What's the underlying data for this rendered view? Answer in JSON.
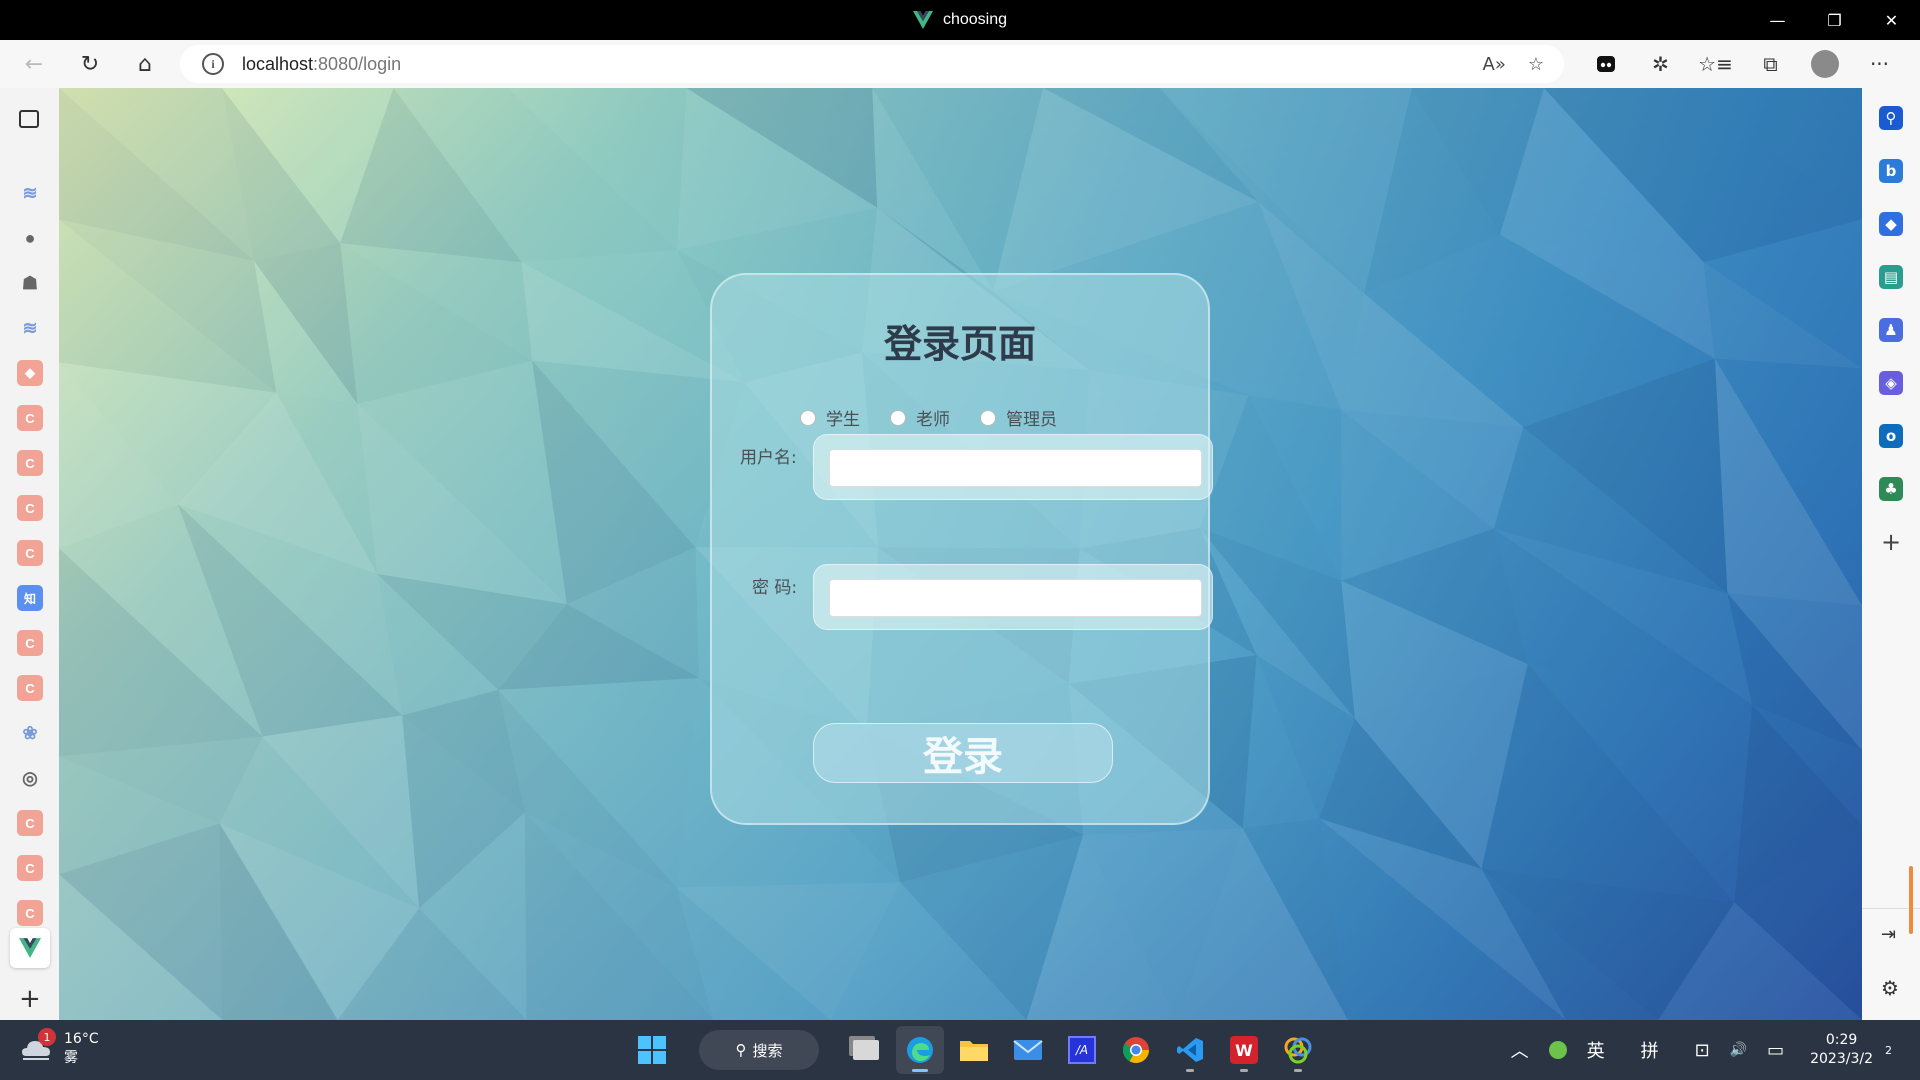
{
  "window": {
    "title": "choosing",
    "minimize_glyph": "—",
    "restore_glyph": "❐",
    "close_glyph": "✕"
  },
  "browser": {
    "url_host": "localhost",
    "url_path": ":8080/login",
    "info_glyph": "i",
    "back_glyph": "←",
    "refresh_glyph": "↻",
    "home_glyph": "⌂",
    "read_aloud_glyph": "A»",
    "favorite_add_glyph": "☆",
    "favorites_glyph": "☆≡",
    "collections_glyph": "⧉",
    "extensions_glyph": "✲",
    "more_glyph": "···"
  },
  "left_tabs": [
    {
      "icon": "layers-icon",
      "glyph": "≋",
      "kind": "soft"
    },
    {
      "icon": "github-icon",
      "glyph": "●",
      "kind": "grey"
    },
    {
      "icon": "robot-icon",
      "glyph": "☗",
      "kind": "grey"
    },
    {
      "icon": "layers-icon",
      "glyph": "≋",
      "kind": "soft"
    },
    {
      "icon": "git-icon",
      "glyph": "◆",
      "kind": "c"
    },
    {
      "icon": "csdn-icon",
      "glyph": "C",
      "kind": "c"
    },
    {
      "icon": "csdn-icon",
      "glyph": "C",
      "kind": "c"
    },
    {
      "icon": "csdn-icon",
      "glyph": "C",
      "kind": "c"
    },
    {
      "icon": "csdn-icon",
      "glyph": "C",
      "kind": "c"
    },
    {
      "icon": "zhihu-icon",
      "glyph": "知",
      "kind": "zh"
    },
    {
      "icon": "csdn-icon",
      "glyph": "C",
      "kind": "c"
    },
    {
      "icon": "csdn-icon",
      "glyph": "C",
      "kind": "c"
    },
    {
      "icon": "baidu-paw-icon",
      "glyph": "❀",
      "kind": "soft"
    },
    {
      "icon": "chrome-like-icon",
      "glyph": "◎",
      "kind": "grey"
    },
    {
      "icon": "csdn-icon",
      "glyph": "C",
      "kind": "c"
    },
    {
      "icon": "csdn-icon",
      "glyph": "C",
      "kind": "c"
    },
    {
      "icon": "csdn-icon",
      "glyph": "C",
      "kind": "c"
    }
  ],
  "left_new_tab_glyph": "+",
  "right_sidebar": [
    {
      "icon": "search-icon",
      "glyph": "⚲",
      "color": "#1a5bd1"
    },
    {
      "icon": "bing-icon",
      "glyph": "b",
      "color": "#2b7bd8"
    },
    {
      "icon": "tag-icon",
      "glyph": "◆",
      "color": "#2f6fe0"
    },
    {
      "icon": "toolbox-icon",
      "glyph": "▤",
      "color": "#2a9d8f"
    },
    {
      "icon": "games-icon",
      "glyph": "♟",
      "color": "#4a6ee0"
    },
    {
      "icon": "office-icon",
      "glyph": "◈",
      "color": "#6a5ee0"
    },
    {
      "icon": "outlook-icon",
      "glyph": "o",
      "color": "#0f6cbd"
    },
    {
      "icon": "tree-icon",
      "glyph": "♣",
      "color": "#2e8b57"
    }
  ],
  "right_add_glyph": "+",
  "right_bottom": {
    "split_glyph": "⇥",
    "settings_glyph": "⚙"
  },
  "login": {
    "title": "登录页面",
    "roles": [
      "学生",
      "老师",
      "管理员"
    ],
    "username_label": "用户名:",
    "password_label": "密 码:",
    "username_value": "",
    "password_value": "",
    "submit_label": "登录"
  },
  "taskbar": {
    "weather_temp": "16°C",
    "weather_desc": "雾",
    "weather_badge": "1",
    "search_label": "搜索",
    "tray_expand_glyph": "︿",
    "ime_lang": "英",
    "ime_mode": "拼",
    "tray_network_glyph": "⊡",
    "tray_volume_glyph": "🔊",
    "tray_battery_glyph": "▭",
    "time": "0:29",
    "date": "2023/3/2",
    "notif_count": "2"
  }
}
